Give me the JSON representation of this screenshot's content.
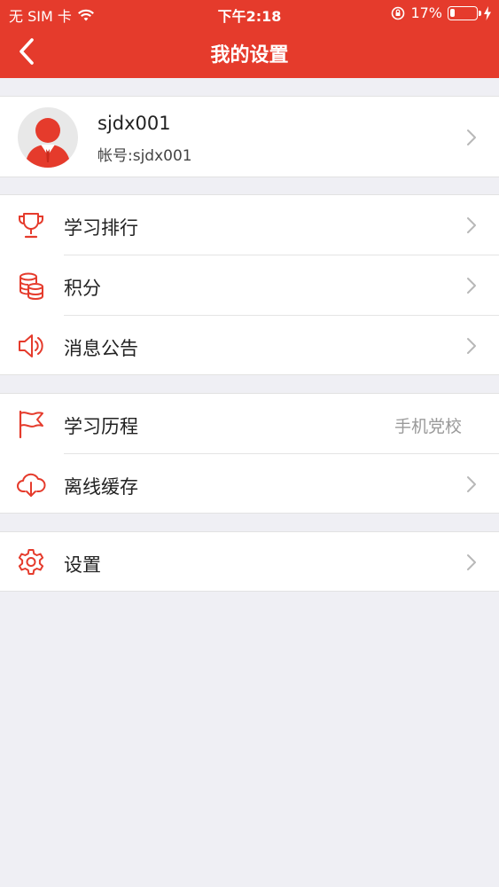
{
  "status_bar": {
    "carrier": "无 SIM 卡",
    "time": "下午2:18",
    "battery": "17%",
    "battery_level": 0.17
  },
  "nav": {
    "title": "我的设置"
  },
  "profile": {
    "name": "sjdx001",
    "account": "帐号:sjdx001"
  },
  "groups": {
    "g1": [
      {
        "label": "学习排行",
        "icon": "trophy-icon"
      },
      {
        "label": "积分",
        "icon": "coins-icon"
      },
      {
        "label": "消息公告",
        "icon": "speaker-icon"
      }
    ],
    "g2": [
      {
        "label": "学习历程",
        "value": "手机党校",
        "icon": "flag-icon"
      },
      {
        "label": "离线缓存",
        "icon": "cloud-download-icon"
      }
    ],
    "g3": [
      {
        "label": "设置",
        "icon": "gear-icon"
      }
    ]
  },
  "colors": {
    "accent": "#e53b2c",
    "background": "#efeff4",
    "value_text": "#9a9a9a"
  }
}
